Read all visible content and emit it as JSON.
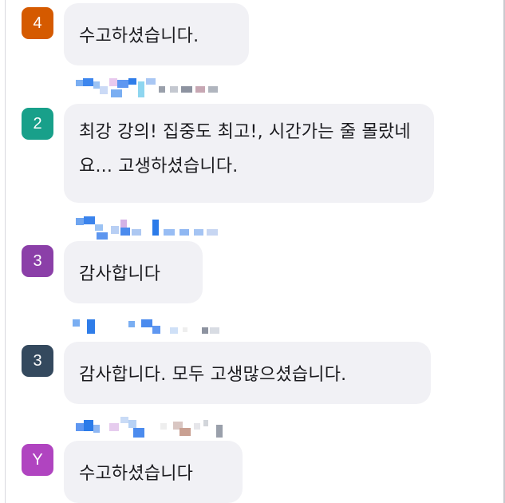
{
  "messages": [
    {
      "avatar_label": "4",
      "avatar_color": "#d55a00",
      "text": "수고하셨습니다.",
      "redacted_sender": false
    },
    {
      "avatar_label": "2",
      "avatar_color": "#18a08a",
      "text": "최강 강의! 집중도 최고!, 시간가는 줄 몰랐네요... 고생하셨습니다.",
      "redacted_sender": true
    },
    {
      "avatar_label": "3",
      "avatar_color": "#8b3fa8",
      "text": "감사합니다",
      "redacted_sender": true
    },
    {
      "avatar_label": "3",
      "avatar_color": "#34495e",
      "text": "감사합니다. 모두 고생많으셨습니다.",
      "redacted_sender": true
    },
    {
      "avatar_label": "Y",
      "avatar_color": "#b044c0",
      "text": "수고하셨습니다",
      "redacted_sender": true
    }
  ],
  "colors": {
    "bubble_bg": "#f1f1f5",
    "text": "#1b1b1f",
    "redaction_blue": "#4a8df0",
    "redaction_gray": "#b6bac4"
  }
}
